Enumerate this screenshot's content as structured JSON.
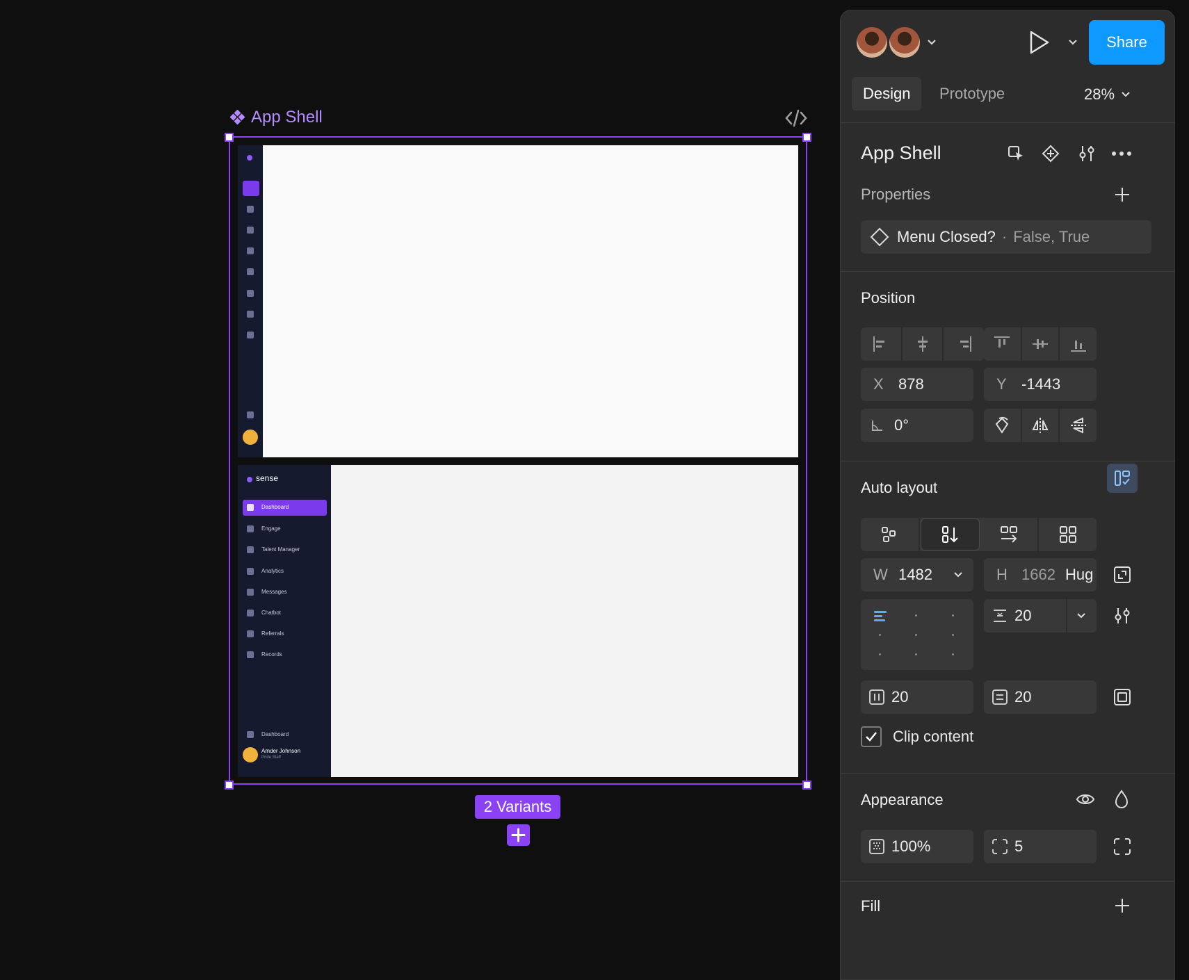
{
  "canvas": {
    "frame_name": "App Shell",
    "variants_label": "2 Variants",
    "variant_collapsed": {
      "nav_icons": [
        "home-icon",
        "engage-icon",
        "talent-icon",
        "analytics-icon",
        "messages-icon",
        "chatbot-icon",
        "referrals-icon",
        "records-icon"
      ]
    },
    "variant_expanded": {
      "brand": "sense",
      "nav": [
        {
          "label": "Dashboard",
          "icon": "home-icon",
          "active": true
        },
        {
          "label": "Engage",
          "icon": "engage-icon"
        },
        {
          "label": "Talent Manager",
          "icon": "talent-icon"
        },
        {
          "label": "Analytics",
          "icon": "analytics-icon"
        },
        {
          "label": "Messages",
          "icon": "messages-icon"
        },
        {
          "label": "Chatbot",
          "icon": "chatbot-icon"
        },
        {
          "label": "Referrals",
          "icon": "referrals-icon"
        },
        {
          "label": "Records",
          "icon": "records-icon"
        }
      ],
      "footer_item": "Dashboard",
      "user_name": "Amder Johnson",
      "user_role": "Pride Staff"
    }
  },
  "panel": {
    "share_label": "Share",
    "tabs": {
      "design": "Design",
      "prototype": "Prototype"
    },
    "zoom": "28%",
    "component_name": "App Shell",
    "properties": {
      "title": "Properties",
      "item_name": "Menu Closed?",
      "item_sep": "·",
      "item_values": "False, True"
    },
    "position": {
      "title": "Position",
      "x_label": "X",
      "x": "878",
      "y_label": "Y",
      "y": "-1443",
      "rotation": "0°"
    },
    "auto_layout": {
      "title": "Auto layout",
      "w_label": "W",
      "w": "1482",
      "h_label": "H",
      "h": "1662",
      "h_mode": "Hug",
      "gap": "20",
      "pad_h": "20",
      "pad_v": "20",
      "clip_label": "Clip content",
      "clip_checked": true
    },
    "appearance": {
      "title": "Appearance",
      "opacity": "100%",
      "radius": "5"
    },
    "fill": {
      "title": "Fill"
    }
  },
  "colors": {
    "accent": "#8b42f5",
    "share": "#0d99ff",
    "panel": "#2c2c2c",
    "canvas": "#0f0f10"
  }
}
